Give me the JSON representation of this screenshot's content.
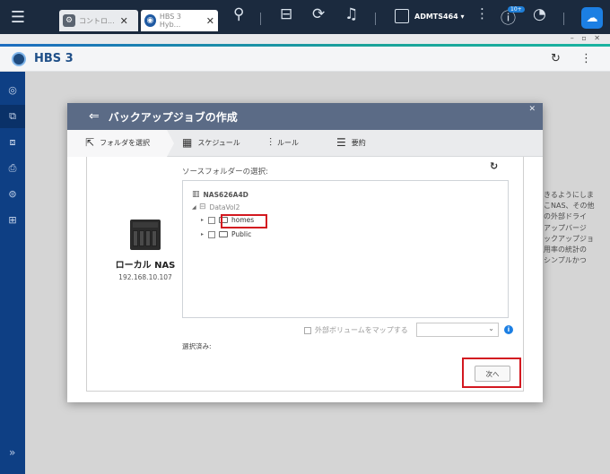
{
  "topbar": {
    "tabs": [
      {
        "label": "コントロ..."
      },
      {
        "label": "HBS 3 Hyb..."
      }
    ],
    "user": "ADMTS464 ▾",
    "badge": "10+"
  },
  "app": {
    "title": "HBS 3"
  },
  "dialog": {
    "title": "バックアップジョブの作成",
    "steps": [
      {
        "label": "フォルダを選択"
      },
      {
        "label": "スケジュール"
      },
      {
        "label": "ルール"
      },
      {
        "label": "要約"
      }
    ],
    "device": {
      "name": "ローカル NAS",
      "ip": "192.168.10.107"
    },
    "source_label": "ソースフォルダーの選択:",
    "tree": {
      "root": "NAS626A4D",
      "volume": "DataVol2",
      "folders": [
        {
          "name": "homes",
          "highlighted": true
        },
        {
          "name": "Public",
          "highlighted": false
        }
      ]
    },
    "map_external": "外部ボリュームをマップする",
    "selected_label": "選択済み:",
    "next_button": "次へ"
  },
  "background_text": "きるようにしま\nこNAS、その他\nの外部ドライ\nアップバージ\nックアップジョ\n用率の統計の\nシンプルかつ",
  "colors": {
    "topbar": "#1b2a3e",
    "sidebar": "#0e3f84",
    "dialog_header": "#5b6b86",
    "highlight": "#d31820",
    "accent": "#1c7fe3"
  }
}
